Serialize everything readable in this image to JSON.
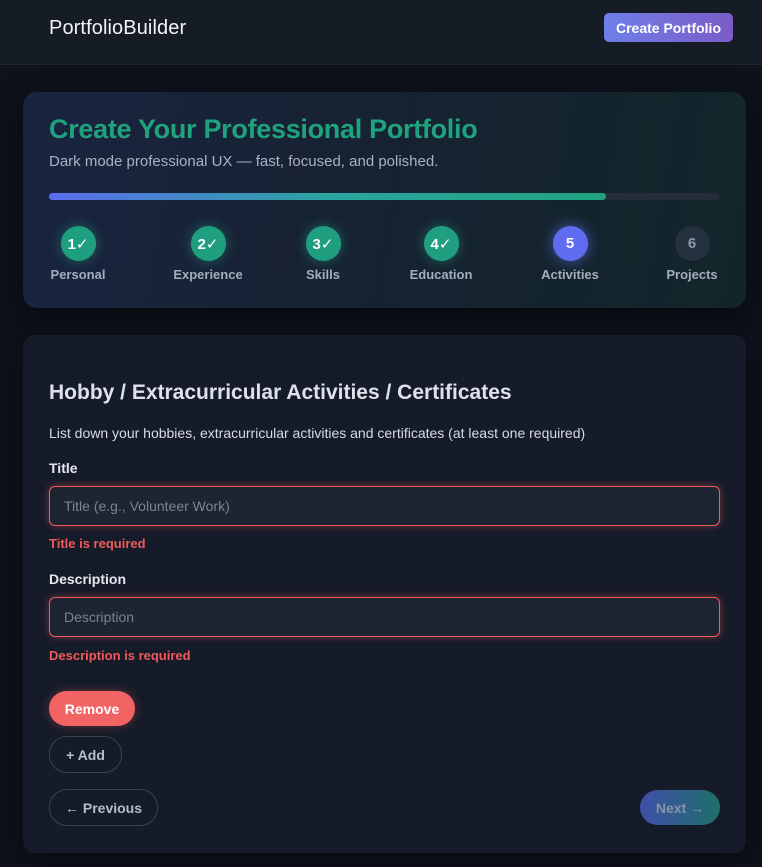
{
  "header": {
    "brand": "PortfolioBuilder",
    "create_button": "Create Portfolio"
  },
  "hero": {
    "title": "Create Your Professional Portfolio",
    "subtitle": "Dark mode professional UX — fast, focused, and polished.",
    "progress": 0.83,
    "steps": [
      {
        "number": "1✓",
        "label": "Personal",
        "state": "done"
      },
      {
        "number": "2✓",
        "label": "Experience",
        "state": "done"
      },
      {
        "number": "3✓",
        "label": "Skills",
        "state": "done"
      },
      {
        "number": "4✓",
        "label": "Education",
        "state": "done"
      },
      {
        "number": "5",
        "label": "Activities",
        "state": "active"
      },
      {
        "number": "6",
        "label": "Projects",
        "state": "todo"
      }
    ]
  },
  "form": {
    "title": "Hobby / Extracurricular Activities / Certificates",
    "description": "List down your hobbies, extracurricular activities and certificates (at least one required)",
    "title_field": {
      "label": "Title",
      "placeholder": "Title (e.g., Volunteer Work)",
      "value": "",
      "error": "Title is required"
    },
    "description_field": {
      "label": "Description",
      "placeholder": "Description",
      "value": "",
      "error": "Description is required"
    },
    "remove_button": "Remove",
    "add_button": "+ Add",
    "prev_button": "← Previous",
    "next_button": "Next →"
  },
  "colors": {
    "accent_green": "#1fa37e",
    "accent_indigo": "#5f6cf0",
    "error_red": "#ef5a5a"
  }
}
